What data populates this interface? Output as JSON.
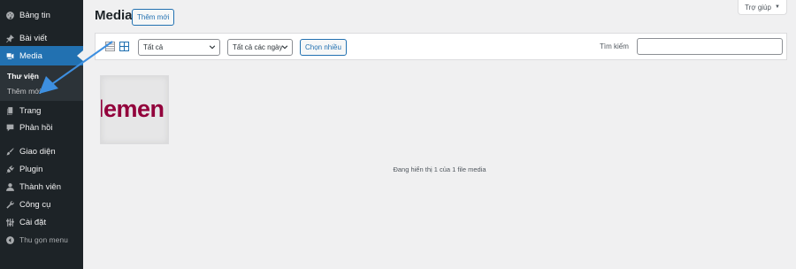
{
  "sidebar": {
    "items": [
      {
        "label": "Bảng tin",
        "icon": "dashboard-icon"
      },
      {
        "label": "Bài viết",
        "icon": "pin-icon"
      },
      {
        "label": "Media",
        "icon": "media-icon"
      },
      {
        "label": "Trang",
        "icon": "page-icon"
      },
      {
        "label": "Phản hồi",
        "icon": "comment-icon"
      },
      {
        "label": "Giao diện",
        "icon": "paintbrush-icon"
      },
      {
        "label": "Plugin",
        "icon": "plugin-icon"
      },
      {
        "label": "Thành viên",
        "icon": "user-icon"
      },
      {
        "label": "Công cụ",
        "icon": "wrench-icon"
      },
      {
        "label": "Cài đặt",
        "icon": "settings-icon"
      }
    ],
    "active_item": "Media",
    "submenu": [
      {
        "label": "Thư viện",
        "current": true
      },
      {
        "label": "Thêm mới",
        "current": false
      }
    ],
    "collapse_label": "Thu gọn menu"
  },
  "header": {
    "title": "Media",
    "add_new_label": "Thêm mới",
    "help_label": "Trợ giúp"
  },
  "toolbar": {
    "filter_type": {
      "selected": "Tất cả"
    },
    "filter_date": {
      "selected": "Tất cả các ngày"
    },
    "bulk_select_label": "Chọn nhiều",
    "search_label": "Tìm kiếm",
    "search_value": ""
  },
  "media": {
    "items": [
      {
        "thumbnail_text": "lemen"
      }
    ],
    "status_text": "Đang hiển thị 1 của 1 file media"
  },
  "colors": {
    "sidebar_bg": "#1d2327",
    "accent": "#2271b1",
    "annotation_arrow": "#3d8fe0",
    "thumbnail_brand": "#92003b"
  }
}
